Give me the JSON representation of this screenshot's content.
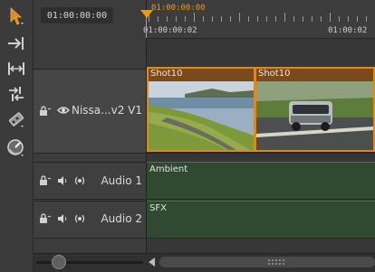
{
  "timecode": {
    "current": "01:00:00:00"
  },
  "ruler": {
    "playhead_label": "01:00:00:00",
    "labels": [
      "01:00:00:02",
      "01:00:02"
    ]
  },
  "tools": [
    "select-tool-icon",
    "insert-edit-icon",
    "fit-icon",
    "trim-icon",
    "blade-icon",
    "speed-icon"
  ],
  "tracks": {
    "video": {
      "name": "Nissa...v2 V1"
    },
    "audio1": {
      "name": "Audio 1"
    },
    "audio2": {
      "name": "Audio 2"
    }
  },
  "clips": {
    "video": [
      {
        "label": "Shot10"
      },
      {
        "label": "Shot10"
      }
    ],
    "audio1": {
      "label": "Ambient"
    },
    "audio2": {
      "label": "SFX"
    }
  },
  "colors": {
    "playhead": "#f39a00",
    "clip_border": "#d98a22",
    "audio_clip": "#2f4a30"
  }
}
